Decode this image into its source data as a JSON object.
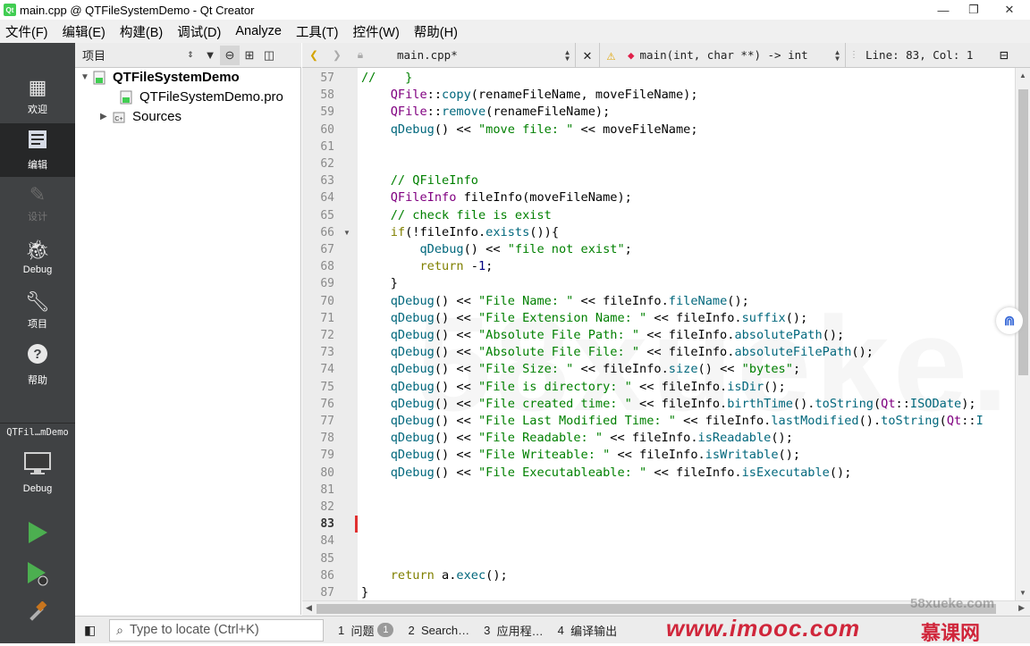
{
  "window": {
    "title": "main.cpp @ QTFileSystemDemo - Qt Creator",
    "minimize": "—",
    "maximize": "❐",
    "close": "✕"
  },
  "menu": [
    "文件(F)",
    "编辑(E)",
    "构建(B)",
    "调试(D)",
    "Analyze",
    "工具(T)",
    "控件(W)",
    "帮助(H)"
  ],
  "modes": {
    "welcome": "欢迎",
    "edit": "编辑",
    "design": "设计",
    "debug": "Debug",
    "projects": "项目",
    "help": "帮助"
  },
  "kit": {
    "project": "QTFil…mDemo",
    "config": "Debug"
  },
  "project_panel": {
    "label": "项目",
    "root": "QTFileSystemDemo",
    "pro_file": "QTFileSystemDemo.pro",
    "sources": "Sources"
  },
  "editor_toolbar": {
    "file": "main.cpp*",
    "symbol": "main(int, char **) -> int",
    "linecol": "Line: 83, Col: 1"
  },
  "code": {
    "first_line": 57,
    "current_line": 83,
    "lines": [
      "//    }",
      "    QFile::copy(renameFileName, moveFileName);",
      "    QFile::remove(renameFileName);",
      "    qDebug() << \"move file: \" << moveFileName;",
      "",
      "",
      "    // QFileInfo",
      "    QFileInfo fileInfo(moveFileName);",
      "    // check file is exist",
      "    if(!fileInfo.exists()){",
      "        qDebug() << \"file not exist\";",
      "        return -1;",
      "    }",
      "    qDebug() << \"File Name: \" << fileInfo.fileName();",
      "    qDebug() << \"File Extension Name: \" << fileInfo.suffix();",
      "    qDebug() << \"Absolute File Path: \" << fileInfo.absolutePath();",
      "    qDebug() << \"Absolute File File: \" << fileInfo.absoluteFilePath();",
      "    qDebug() << \"File Size: \" << fileInfo.size() << \"bytes\";",
      "    qDebug() << \"File is directory: \" << fileInfo.isDir();",
      "    qDebug() << \"File created time: \" << fileInfo.birthTime().toString(Qt::ISODate);",
      "    qDebug() << \"File Last Modified Time: \" << fileInfo.lastModified().toString(Qt::I",
      "    qDebug() << \"File Readable: \" << fileInfo.isReadable();",
      "    qDebug() << \"File Writeable: \" << fileInfo.isWritable();",
      "    qDebug() << \"File Executableable: \" << fileInfo.isExecutable();",
      "",
      "",
      "",
      "",
      "",
      "    return a.exec();",
      "}"
    ]
  },
  "status": {
    "locator_placeholder": "Type to locate (Ctrl+K)",
    "panes": [
      {
        "num": "1",
        "label": "问题",
        "badge": "1"
      },
      {
        "num": "2",
        "label": "Search…"
      },
      {
        "num": "3",
        "label": "应用程…"
      },
      {
        "num": "4",
        "label": "编译输出"
      }
    ]
  },
  "watermarks": {
    "big": "58xueke.com",
    "site": "58xueke.com",
    "imooc": "www.imooc.com",
    "mooc": "慕课网"
  },
  "colors": {
    "modebar": "#404244",
    "keyword": "#808000",
    "type": "#800080",
    "function": "#00677c",
    "string": "#008000",
    "comment": "#008000"
  }
}
